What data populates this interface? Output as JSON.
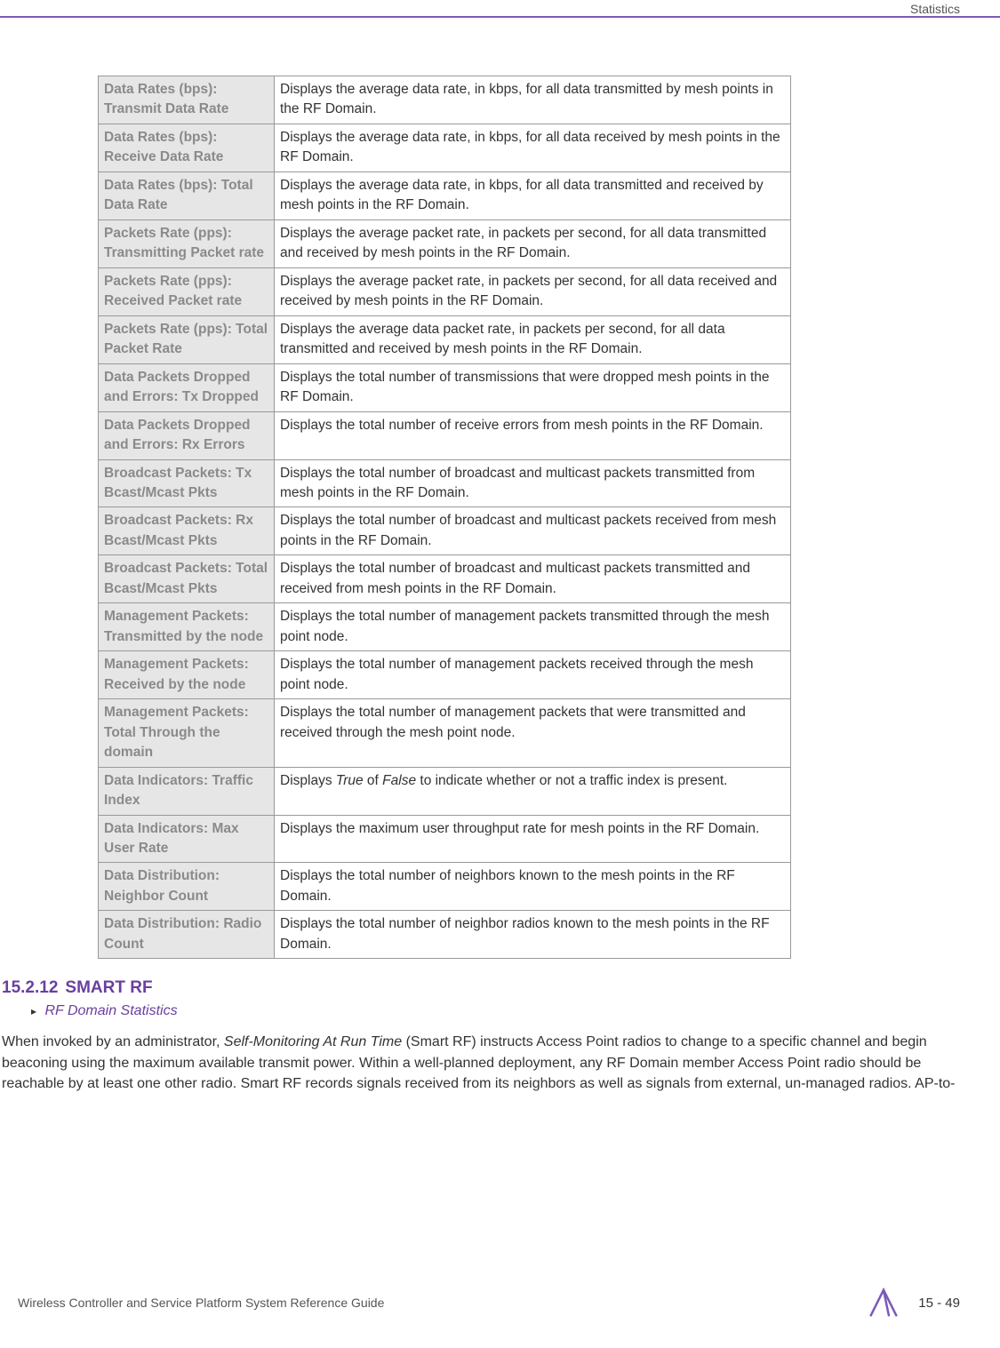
{
  "header": {
    "section": "Statistics"
  },
  "table": {
    "rows": [
      {
        "term": "Data Rates (bps): Transmit Data Rate",
        "desc": "Displays the average data rate, in kbps, for all data transmitted by mesh points in the RF Domain."
      },
      {
        "term": "Data Rates (bps): Receive Data Rate",
        "desc": "Displays the average data rate, in kbps, for all data received by mesh points in the RF Domain."
      },
      {
        "term": "Data Rates (bps): Total Data Rate",
        "desc": "Displays the average data rate, in kbps, for all data transmitted and received by mesh points in the RF Domain."
      },
      {
        "term": "Packets Rate (pps): Transmitting Packet rate",
        "desc": "Displays the average packet rate, in packets per second, for all data transmitted and received by mesh points in the RF Domain."
      },
      {
        "term": "Packets Rate (pps): Received Packet rate",
        "desc": "Displays the average packet rate, in packets per second, for all data received and received by mesh points in the RF Domain."
      },
      {
        "term": "Packets Rate (pps): Total Packet Rate",
        "desc": "Displays the average data packet rate, in packets per second, for all data transmitted and received by mesh points in the RF Domain."
      },
      {
        "term": "Data Packets Dropped and Errors: Tx Dropped",
        "desc": "Displays the total number of transmissions that were dropped mesh points in the RF Domain."
      },
      {
        "term": "Data Packets Dropped and Errors: Rx Errors",
        "desc": "Displays the total number of receive errors from mesh points in the RF Domain."
      },
      {
        "term": "Broadcast Packets: Tx Bcast/Mcast Pkts",
        "desc": "Displays the total number of broadcast and multicast packets transmitted from mesh points in the RF Domain."
      },
      {
        "term": "Broadcast Packets: Rx Bcast/Mcast Pkts",
        "desc": "Displays the total number of broadcast and multicast packets received from mesh points in the RF Domain."
      },
      {
        "term": "Broadcast Packets: Total Bcast/Mcast Pkts",
        "desc": "Displays the total number of broadcast and multicast packets transmitted and received from mesh points in the RF Domain."
      },
      {
        "term": "Management Packets: Transmitted by the node",
        "desc": "Displays the total number of management packets transmitted through the mesh point node."
      },
      {
        "term": "Management Packets: Received by the node",
        "desc": "Displays the total number of management packets received through the mesh point node."
      },
      {
        "term": "Management Packets: Total Through the domain",
        "desc": "Displays the total number of management packets that were transmitted and received through the mesh point node."
      },
      {
        "term": "Data Indicators: Traffic Index",
        "desc_html": "Displays <span class=\"italic-inline\">True</span> of <span class=\"italic-inline\">False</span> to indicate whether or not a traffic index is present."
      },
      {
        "term": "Data Indicators: Max User Rate",
        "desc": "Displays the maximum user throughput rate for mesh points in the RF Domain."
      },
      {
        "term": "Data Distribution: Neighbor Count",
        "desc": "Displays the total number of neighbors known to the mesh points in the RF Domain."
      },
      {
        "term": "Data Distribution: Radio Count",
        "desc": "Displays the total number of neighbor radios known to the mesh points in the RF Domain."
      }
    ]
  },
  "section": {
    "number": "15.2.12",
    "title": "SMART RF",
    "breadcrumb": "RF Domain Statistics",
    "paragraph_pre": "When invoked by an administrator, ",
    "paragraph_italic": "Self-Monitoring At Run Time",
    "paragraph_post": " (Smart RF) instructs Access Point radios to change to a specific channel and begin beaconing using the maximum available transmit power. Within a well-planned deployment, any RF Domain member Access Point radio should be reachable by at least one other radio. Smart RF records signals received from its neighbors as well as signals from external, un-managed radios. AP-to-"
  },
  "footer": {
    "left": "Wireless Controller and Service Platform System Reference Guide",
    "page": "15 - 49"
  }
}
